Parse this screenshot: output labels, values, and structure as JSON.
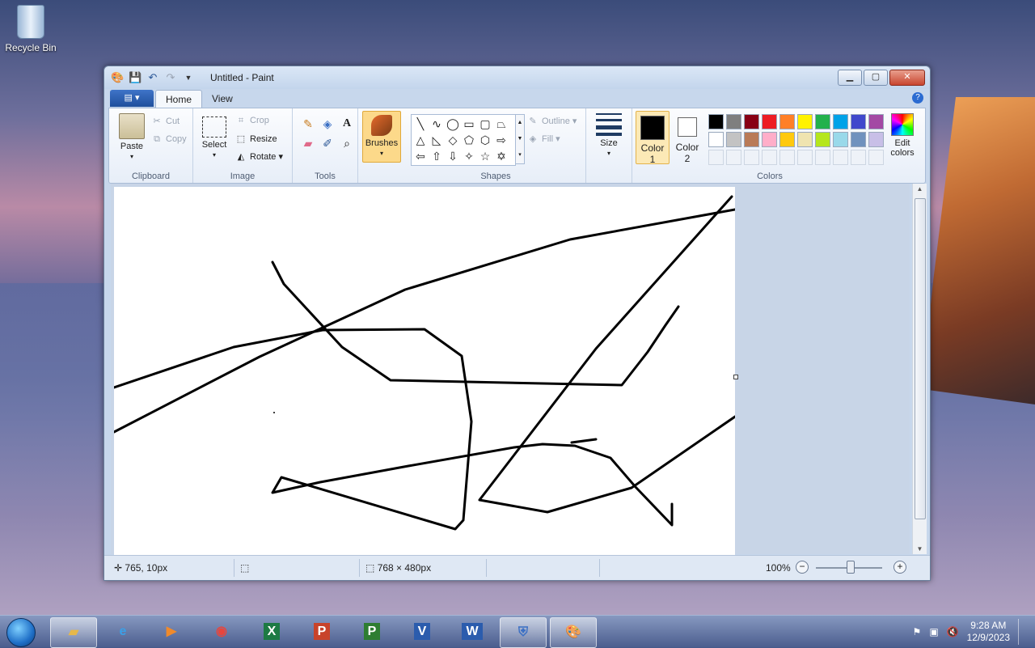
{
  "desktop": {
    "recycle_bin_label": "Recycle Bin"
  },
  "window": {
    "title": "Untitled - Paint"
  },
  "tabs": {
    "home": "Home",
    "view": "View"
  },
  "clipboard": {
    "paste": "Paste",
    "cut": "Cut",
    "copy": "Copy",
    "label": "Clipboard"
  },
  "image": {
    "select": "Select",
    "crop": "Crop",
    "resize": "Resize",
    "rotate": "Rotate",
    "label": "Image"
  },
  "tools": {
    "label": "Tools"
  },
  "brushes": {
    "label": "Brushes"
  },
  "shapes": {
    "outline": "Outline",
    "fill": "Fill",
    "label": "Shapes"
  },
  "size": {
    "label": "Size"
  },
  "colors": {
    "color1_label": "Color",
    "color1_num": "1",
    "color2_label": "Color",
    "color2_num": "2",
    "edit_colors_label_1": "Edit",
    "edit_colors_label_2": "colors",
    "label": "Colors",
    "palette_row1": [
      "#000000",
      "#7f7f7f",
      "#880015",
      "#ed1c24",
      "#ff7f27",
      "#fff200",
      "#22b14c",
      "#00a2e8",
      "#3f48cc",
      "#a349a4"
    ],
    "palette_row2": [
      "#ffffff",
      "#c3c3c3",
      "#b97a57",
      "#ffaec9",
      "#ffc90e",
      "#efe4b0",
      "#b5e61d",
      "#99d9ea",
      "#7092be",
      "#c8bfe7"
    ]
  },
  "statusbar": {
    "cursor_position": "765, 10px",
    "canvas_size": "768 × 480px",
    "zoom": "100%"
  },
  "taskbar": {
    "apps": [
      "Explorer",
      "Internet Explorer",
      "Media Player",
      "Chrome",
      "Excel",
      "PowerPoint",
      "Project",
      "Visio",
      "Word",
      "Security",
      "Paint"
    ],
    "time": "9:28 AM",
    "date": "12/9/2023"
  }
}
